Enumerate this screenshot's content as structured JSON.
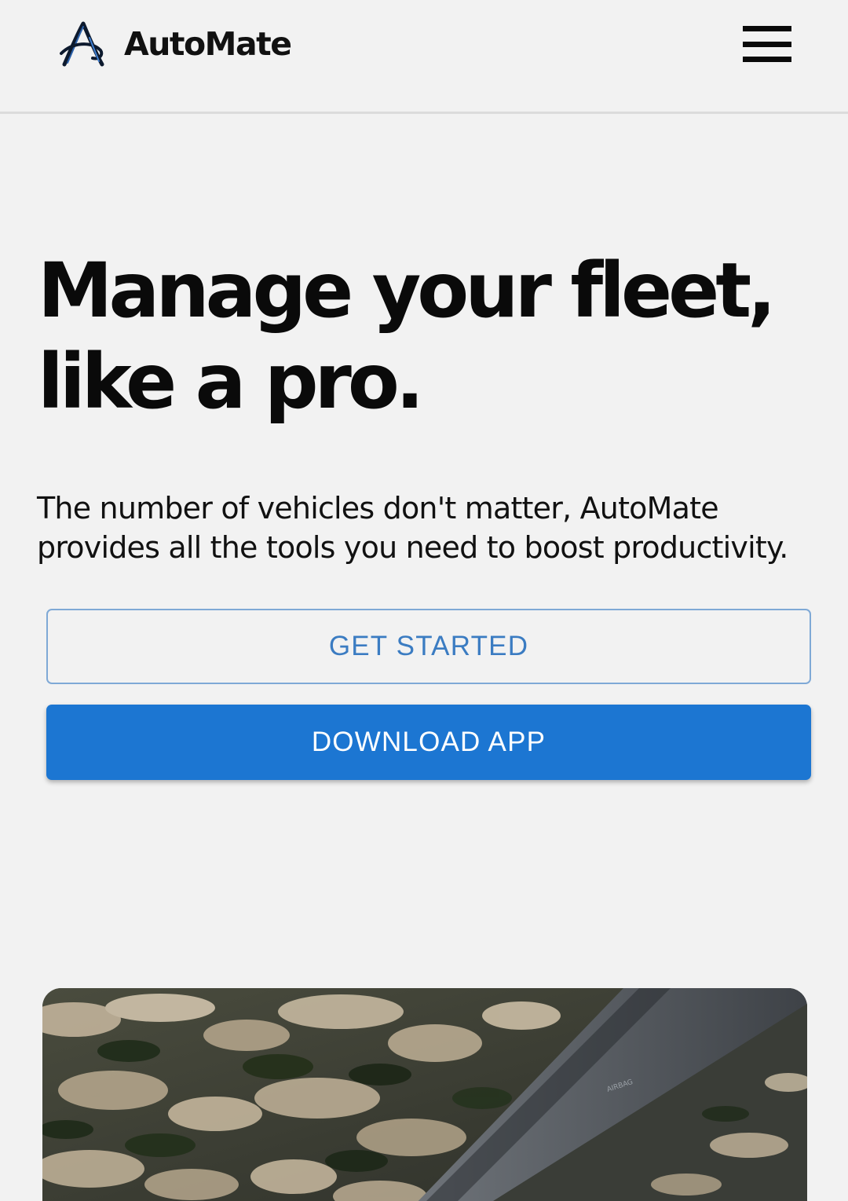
{
  "header": {
    "brand_name": "AutoMate",
    "logo_icon": "automate-logo-icon",
    "menu_icon": "hamburger-menu-icon"
  },
  "hero": {
    "title_line1": "Manage your fleet,",
    "title_line2": "like a pro.",
    "description": "The number of vehicles don't matter, AutoMate provides all the tools you need to boost productivity.",
    "primary_cta": "GET STARTED",
    "secondary_cta": "DOWNLOAD APP",
    "image_label": "AIRBAG"
  },
  "colors": {
    "background": "#f2f2f2",
    "accent_blue": "#1c76d2",
    "outline_text": "#3b7cc2",
    "outline_border": "#7fa9d6",
    "text": "#111111"
  }
}
